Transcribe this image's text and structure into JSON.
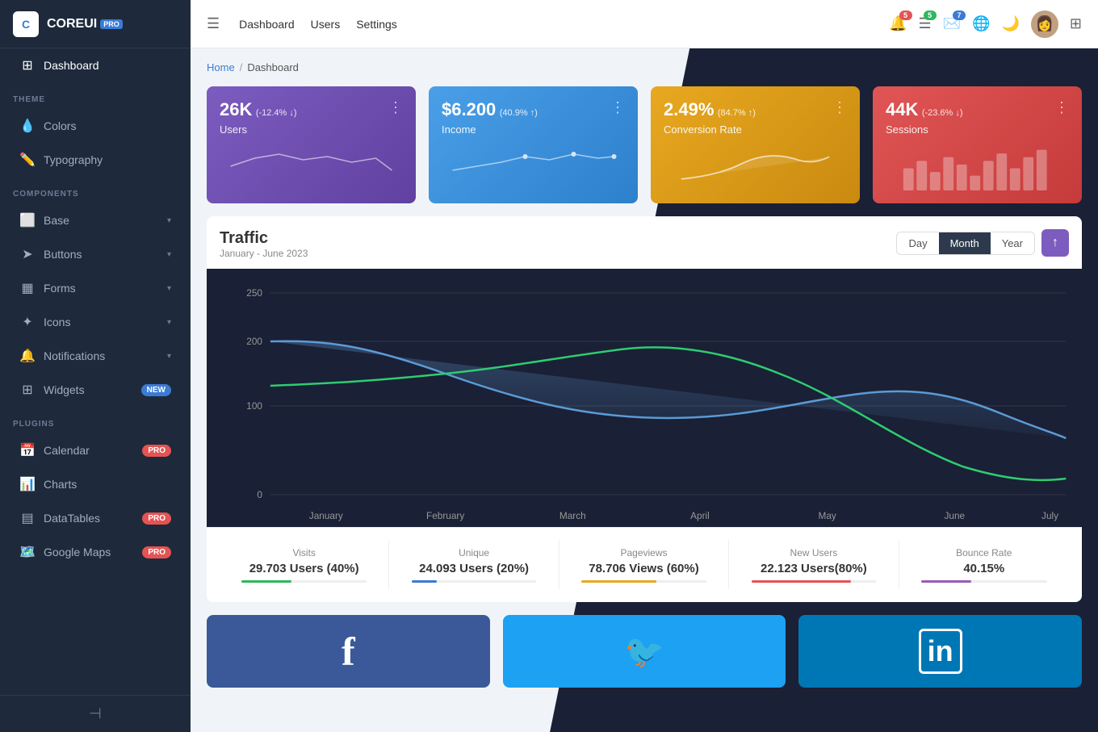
{
  "sidebar": {
    "logo": {
      "text": "COREUI",
      "badge": "PRO",
      "icon": "C"
    },
    "nav": {
      "dashboard_label": "Dashboard"
    },
    "sections": [
      {
        "id": "theme",
        "label": "THEME",
        "items": [
          {
            "id": "colors",
            "label": "Colors",
            "icon": "droplet"
          },
          {
            "id": "typography",
            "label": "Typography",
            "icon": "pen"
          }
        ]
      },
      {
        "id": "components",
        "label": "COMPONENTS",
        "items": [
          {
            "id": "base",
            "label": "Base",
            "icon": "box",
            "hasChevron": true
          },
          {
            "id": "buttons",
            "label": "Buttons",
            "icon": "arrow",
            "hasChevron": true
          },
          {
            "id": "forms",
            "label": "Forms",
            "icon": "form",
            "hasChevron": true
          },
          {
            "id": "icons",
            "label": "Icons",
            "icon": "star",
            "hasChevron": true
          },
          {
            "id": "notifications",
            "label": "Notifications",
            "icon": "bell",
            "hasChevron": true
          },
          {
            "id": "widgets",
            "label": "Widgets",
            "icon": "grid",
            "badge": "NEW",
            "badgeClass": "badge-new"
          }
        ]
      },
      {
        "id": "plugins",
        "label": "PLUGINS",
        "items": [
          {
            "id": "calendar",
            "label": "Calendar",
            "icon": "cal",
            "badge": "PRO",
            "badgeClass": "badge-pro"
          },
          {
            "id": "charts",
            "label": "Charts",
            "icon": "chart"
          },
          {
            "id": "datatables",
            "label": "DataTables",
            "icon": "table",
            "badge": "PRO",
            "badgeClass": "badge-pro"
          },
          {
            "id": "googlemaps",
            "label": "Google Maps",
            "icon": "map",
            "badge": "PRO",
            "badgeClass": "badge-pro"
          }
        ]
      }
    ]
  },
  "header": {
    "hamburger_icon": "☰",
    "nav_items": [
      "Dashboard",
      "Users",
      "Settings"
    ],
    "icons": {
      "bell_badge": "5",
      "list_badge": "5",
      "email_badge": "7"
    }
  },
  "breadcrumb": {
    "home": "Home",
    "separator": "/",
    "current": "Dashboard"
  },
  "stat_cards": [
    {
      "id": "users",
      "value": "26K",
      "change": "(-12.4% ↓)",
      "label": "Users",
      "class": "stat-card-purple"
    },
    {
      "id": "income",
      "value": "$6.200",
      "change": "(40.9% ↑)",
      "label": "Income",
      "class": "stat-card-blue"
    },
    {
      "id": "conversion",
      "value": "2.49%",
      "change": "(84.7% ↑)",
      "label": "Conversion Rate",
      "class": "stat-card-yellow"
    },
    {
      "id": "sessions",
      "value": "44K",
      "change": "(-23.6% ↓)",
      "label": "Sessions",
      "class": "stat-card-red"
    }
  ],
  "traffic": {
    "title": "Traffic",
    "subtitle": "January - June 2023",
    "buttons": [
      "Day",
      "Month",
      "Year"
    ],
    "active_button": "Month",
    "upload_icon": "↑",
    "chart": {
      "y_labels": [
        "250",
        "200",
        "100",
        "0"
      ],
      "x_labels": [
        "January",
        "February",
        "March",
        "April",
        "May",
        "June",
        "July"
      ]
    },
    "stats": [
      {
        "label": "Visits",
        "value": "29.703 Users (40%)",
        "bar_color": "#2eb85c",
        "bar_width": "40%"
      },
      {
        "label": "Unique",
        "value": "24.093 Users (20%)",
        "bar_color": "#3a7bd5",
        "bar_width": "20%"
      },
      {
        "label": "Pageviews",
        "value": "78.706 Views (60%)",
        "bar_color": "#e8a820",
        "bar_width": "60%"
      },
      {
        "label": "New Users",
        "value": "22.123 Users(80%)",
        "bar_color": "#e55353",
        "bar_width": "80%"
      },
      {
        "label": "Bounce Rate",
        "value": "40.15%",
        "bar_color": "#9b59b6",
        "bar_width": "40%"
      }
    ]
  },
  "social": {
    "cards": [
      {
        "id": "facebook",
        "icon": "f",
        "class": "social-fb"
      },
      {
        "id": "twitter",
        "icon": "🐦",
        "class": "social-tw"
      },
      {
        "id": "linkedin",
        "icon": "in",
        "class": "social-li"
      }
    ]
  }
}
